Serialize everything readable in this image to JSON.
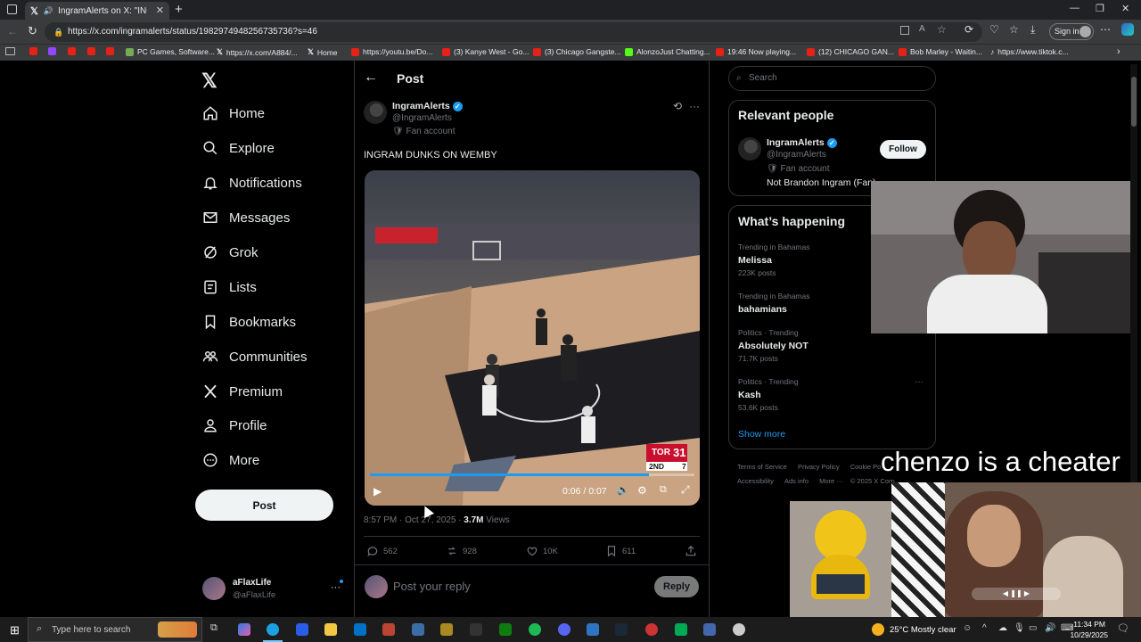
{
  "browser": {
    "tab_title": "IngramAlerts on X: \"INGRAM...",
    "url": "https://x.com/ingramalerts/status/1982974948256735736?s=46",
    "sign_in": "Sign in",
    "bookmarks": [
      "PC Games, Software...",
      "https://x.com/A884/...",
      "Home",
      "https://youtu.be/Do...",
      "(3) Kanye West - Go...",
      "(3) Chicago Gangste...",
      "AlonzoJust Chatting...",
      "19:46 Now playing...",
      "(12) CHICAGO GAN...",
      "Bob Marley - Waitin...",
      "https://www.tiktok.c..."
    ]
  },
  "nav": {
    "items": [
      "Home",
      "Explore",
      "Notifications",
      "Messages",
      "Grok",
      "Lists",
      "Bookmarks",
      "Communities",
      "Premium",
      "Profile",
      "More"
    ],
    "post_label": "Post",
    "account_name": "aFlaxLife",
    "account_handle": "@aFlaxLife"
  },
  "post": {
    "header": "Post",
    "author_name": "IngramAlerts",
    "author_handle": "@IngramAlerts",
    "fan_account": "Fan account",
    "text": "INGRAM DUNKS ON WEMBY",
    "video_time": "0:06 / 0:07",
    "video_progress": 0.86,
    "score_team": "TOR",
    "score_value": "31",
    "score_quarter": "2ND",
    "score_extra": "7",
    "timestamp": "8:57 PM · Oct 27, 2025 ·",
    "views_count": "3.7M",
    "views_label": "Views",
    "replies": "562",
    "reposts": "928",
    "likes": "10K",
    "bookmarks": "611",
    "reply_placeholder": "Post your reply",
    "reply_button": "Reply"
  },
  "right": {
    "search_placeholder": "Search",
    "relevant_title": "Relevant people",
    "person_name": "IngramAlerts",
    "person_handle": "@IngramAlerts",
    "person_fan": "Fan account",
    "person_bio": "Not Brandon Ingram (Fan)",
    "follow_label": "Follow",
    "happening_title": "What’s happening",
    "trends": [
      {
        "context": "Trending in Bahamas",
        "name": "Melissa",
        "count": "223K posts"
      },
      {
        "context": "Trending in Bahamas",
        "name": "bahamians",
        "count": ""
      },
      {
        "context": "Politics · Trending",
        "name": "Absolutely NOT",
        "count": "71.7K posts"
      },
      {
        "context": "Politics · Trending",
        "name": "Kash",
        "count": "53.6K posts"
      }
    ],
    "show_more": "Show more",
    "footer1": [
      "Terms of Service",
      "Privacy Policy",
      "Cookie Po"
    ],
    "footer2": [
      "Accessibility",
      "Ads info",
      "More ···",
      "© 2025 X Corp."
    ]
  },
  "overlay": {
    "caption": "chenzo is a cheater"
  },
  "taskbar": {
    "search_placeholder": "Type here to search",
    "weather": "25°C  Mostly clear",
    "time": "11:34 PM",
    "date": "10/29/2025"
  },
  "colors": {
    "accent": "#1d9bf0",
    "background": "#000000",
    "border": "#2f3336",
    "muted": "#71767b"
  }
}
